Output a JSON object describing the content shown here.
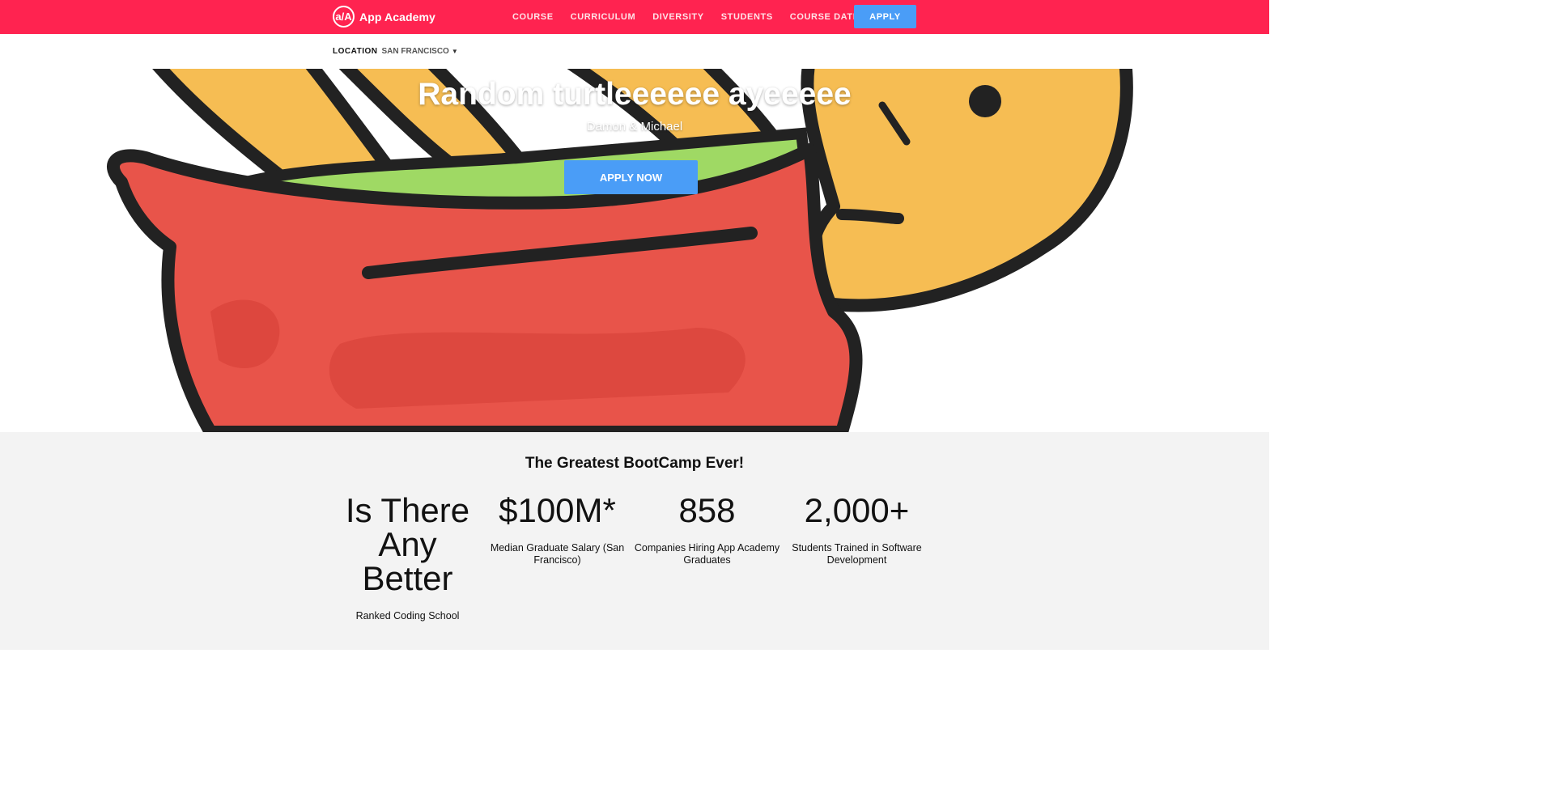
{
  "brand": {
    "logo_text": "a/A",
    "name": "App Academy"
  },
  "nav": {
    "links": [
      "COURSE",
      "CURRICULUM",
      "DIVERSITY",
      "STUDENTS",
      "COURSE DATES"
    ],
    "apply_label": "APPLY"
  },
  "location": {
    "label": "LOCATION",
    "value": "SAN FRANCISCO"
  },
  "hero": {
    "title": "Random turtleeeeee ayeeeee",
    "subtitle": "Damon & Michael",
    "cta_label": "APPLY NOW"
  },
  "stats": {
    "heading": "The Greatest BootCamp Ever!",
    "items": [
      {
        "value": "Is There Any Better",
        "desc": "Ranked Coding School"
      },
      {
        "value": "$100M*",
        "desc": "Median Graduate Salary (San Francisco)"
      },
      {
        "value": "858",
        "desc": "Companies Hiring App Academy Graduates"
      },
      {
        "value": "2,000+",
        "desc": "Students Trained in Software Development"
      }
    ]
  },
  "colors": {
    "nav_bg": "#ff2350",
    "button_blue": "#4a9df7",
    "stats_bg": "#f3f3f3"
  }
}
